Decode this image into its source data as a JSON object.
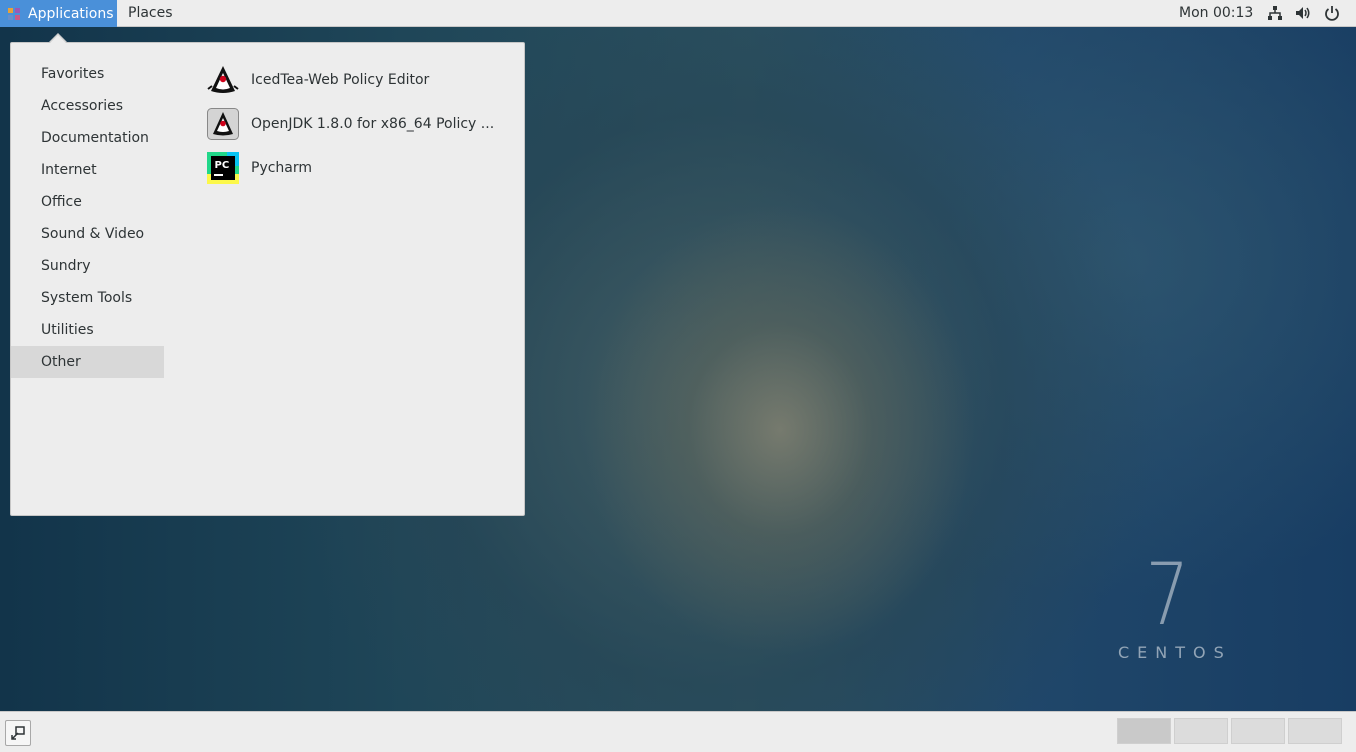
{
  "top_panel": {
    "applications_label": "Applications",
    "places_label": "Places",
    "clock": "Mon 00:13"
  },
  "menu": {
    "categories": [
      {
        "label": "Favorites"
      },
      {
        "label": "Accessories"
      },
      {
        "label": "Documentation"
      },
      {
        "label": "Internet"
      },
      {
        "label": "Office"
      },
      {
        "label": "Sound & Video"
      },
      {
        "label": "Sundry"
      },
      {
        "label": "System Tools"
      },
      {
        "label": "Utilities"
      },
      {
        "label": "Other",
        "selected": true
      }
    ],
    "apps": [
      {
        "label": "IcedTea-Web Policy Editor",
        "icon": "java-duke-icon"
      },
      {
        "label": "OpenJDK 1.8.0 for x86_64 Policy ...",
        "icon": "openjdk-duke-icon"
      },
      {
        "label": "Pycharm",
        "icon": "pycharm-icon"
      }
    ]
  },
  "desktop": {
    "version_mark": "7",
    "brand_word": "CENTOS"
  },
  "colors": {
    "accent": "#4a90d9",
    "panel_bg": "#ededed",
    "selected_bg": "#d8d8d8"
  }
}
